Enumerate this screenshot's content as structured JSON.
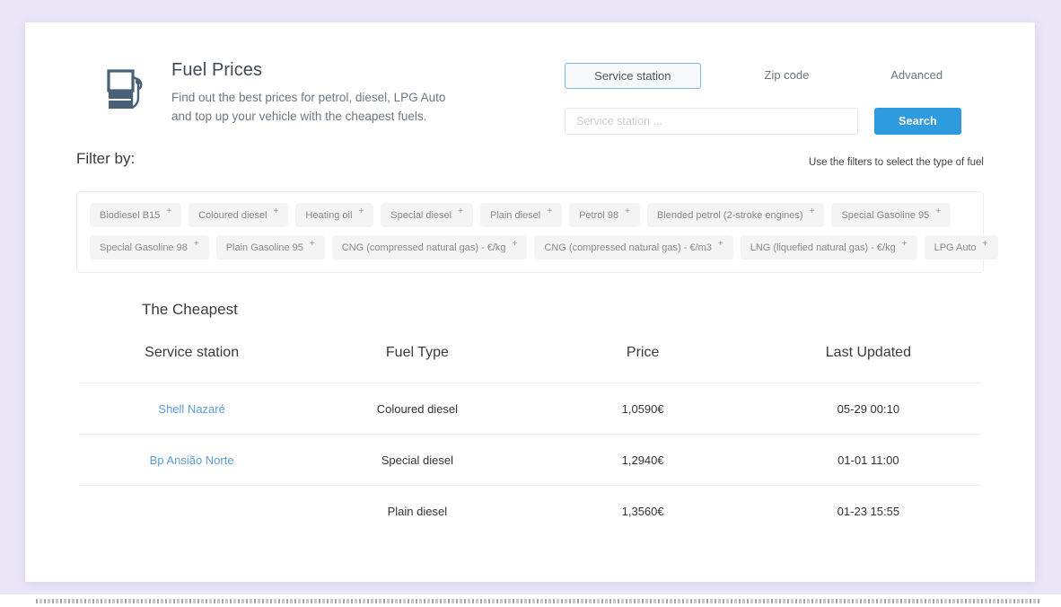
{
  "brand": {
    "icon": "fuel-pump-icon",
    "title": "Fuel Prices",
    "subtitle": "Find out the best prices for petrol, diesel, LPG Auto and top up your vehicle with the cheapest fuels."
  },
  "search": {
    "tabs": [
      {
        "label": "Service station",
        "active": true
      },
      {
        "label": "Zip code",
        "active": false
      },
      {
        "label": "Advanced",
        "active": false
      }
    ],
    "input_value": "",
    "placeholder": "Service station ...",
    "button_label": "Search"
  },
  "filters": {
    "heading": "Filter by:",
    "hint": "Use the filters to select the type of fuel",
    "add_symbol": "+",
    "rows": [
      [
        "Biodiesel B15",
        "Coloured diesel",
        "Heating oil",
        "Special diesel",
        "Plain diesel",
        "Petrol 98",
        "Blended petrol (2-stroke engines)",
        "Special Gasoline 95"
      ],
      [
        "Special Gasoline 98",
        "Plain Gasoline 95",
        "CNG (compressed natural gas) - €/kg",
        "CNG (compressed natural gas) - €/m3",
        "LNG (liquefied natural gas) - €/kg",
        "LPG Auto"
      ]
    ]
  },
  "table": {
    "title": "The Cheapest",
    "columns": [
      "Service station",
      "Fuel Type",
      "Price",
      "Last Updated"
    ],
    "rows": [
      {
        "station": "Shell Nazaré",
        "fuel_type": "Coloured diesel",
        "price": "1,0590€",
        "last_updated": "05-29 00:10"
      },
      {
        "station": "Bp Ansião Norte",
        "fuel_type": "Special diesel",
        "price": "1,2940€",
        "last_updated": "01-01 11:00"
      },
      {
        "station": "",
        "fuel_type": "Plain diesel",
        "price": "1,3560€",
        "last_updated": "01-23 15:55"
      }
    ]
  },
  "colors": {
    "page_background": "#eae6f7",
    "card_background": "#ffffff",
    "accent_blue": "#2e9bdf",
    "link_blue": "#5b9bd5",
    "icon_slate": "#4a6077",
    "chip_background": "#f4f4f4"
  }
}
